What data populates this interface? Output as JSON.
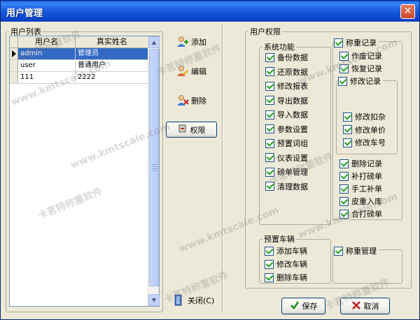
{
  "window": {
    "title": "用户管理",
    "close_glyph": "✕"
  },
  "user_list": {
    "legend": "用户列表",
    "columns": [
      "用户名",
      "真实姓名"
    ],
    "rows": [
      {
        "username": "admin",
        "realname": "管理员",
        "selected": true
      },
      {
        "username": "user",
        "realname": "普通用户",
        "selected": false
      },
      {
        "username": "111",
        "realname": "2222",
        "selected": false
      }
    ]
  },
  "actions": {
    "add": "添加",
    "edit": "编辑",
    "delete": "删除",
    "permission": "权限",
    "close": "关闭(C)"
  },
  "permissions": {
    "legend": "用户权限",
    "system": {
      "legend": "系统功能",
      "items": [
        "备份数据",
        "还原数据",
        "修改报表",
        "导出数据",
        "导入数据",
        "参数设置",
        "预置词组",
        "仪表设置",
        "磅单管理",
        "清理数据"
      ]
    },
    "weigh_record": {
      "title": "称重记录",
      "items_top": [
        "作废记录",
        "恢复记录"
      ],
      "modify_title": "修改记录",
      "modify_items": [
        "修改扣杂",
        "修改单价",
        "修改车号"
      ],
      "items_bottom": [
        "删除记录",
        "补打磅单",
        "手工补单",
        "皮重入库",
        "合打磅单"
      ]
    },
    "vehicles": {
      "legend": "预置车辆",
      "items": [
        "添加车辆",
        "修改车辆",
        "删除车辆"
      ]
    },
    "weigh_manage": "称重管理"
  },
  "footer": {
    "save": "保存",
    "cancel": "取消"
  },
  "watermark": "卡茗特称重软件",
  "watermark_url": "www.kmtscale.com"
}
